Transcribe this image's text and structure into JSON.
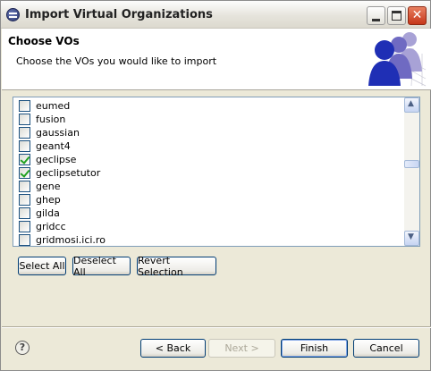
{
  "window": {
    "title": "Import Virtual Organizations",
    "close_glyph": "✕"
  },
  "banner": {
    "title": "Choose VOs",
    "description": "Choose the VOs you would like to import",
    "graphic_icon": "vo-people-icon"
  },
  "vo_list": {
    "items": [
      {
        "label": "eumed",
        "checked": false
      },
      {
        "label": "fusion",
        "checked": false
      },
      {
        "label": "gaussian",
        "checked": false
      },
      {
        "label": "geant4",
        "checked": false
      },
      {
        "label": "geclipse",
        "checked": true
      },
      {
        "label": "geclipsetutor",
        "checked": true
      },
      {
        "label": "gene",
        "checked": false
      },
      {
        "label": "ghep",
        "checked": false
      },
      {
        "label": "gilda",
        "checked": false
      },
      {
        "label": "gridcc",
        "checked": false
      },
      {
        "label": "gridmosi.ici.ro",
        "checked": false
      }
    ],
    "scroll_up_glyph": "▲",
    "scroll_down_glyph": "▼"
  },
  "selection_buttons": {
    "select_all": "Select All",
    "deselect_all": "Deselect All",
    "revert_selection": "Revert Selection"
  },
  "footer": {
    "help_glyph": "?",
    "back": "< Back",
    "next": "Next >",
    "finish": "Finish",
    "cancel": "Cancel"
  },
  "colors": {
    "dialog_bg": "#ece9d8",
    "check_mark": "#21a121",
    "person_front": "#1f2fb5",
    "person_back": "#8c84c8"
  }
}
